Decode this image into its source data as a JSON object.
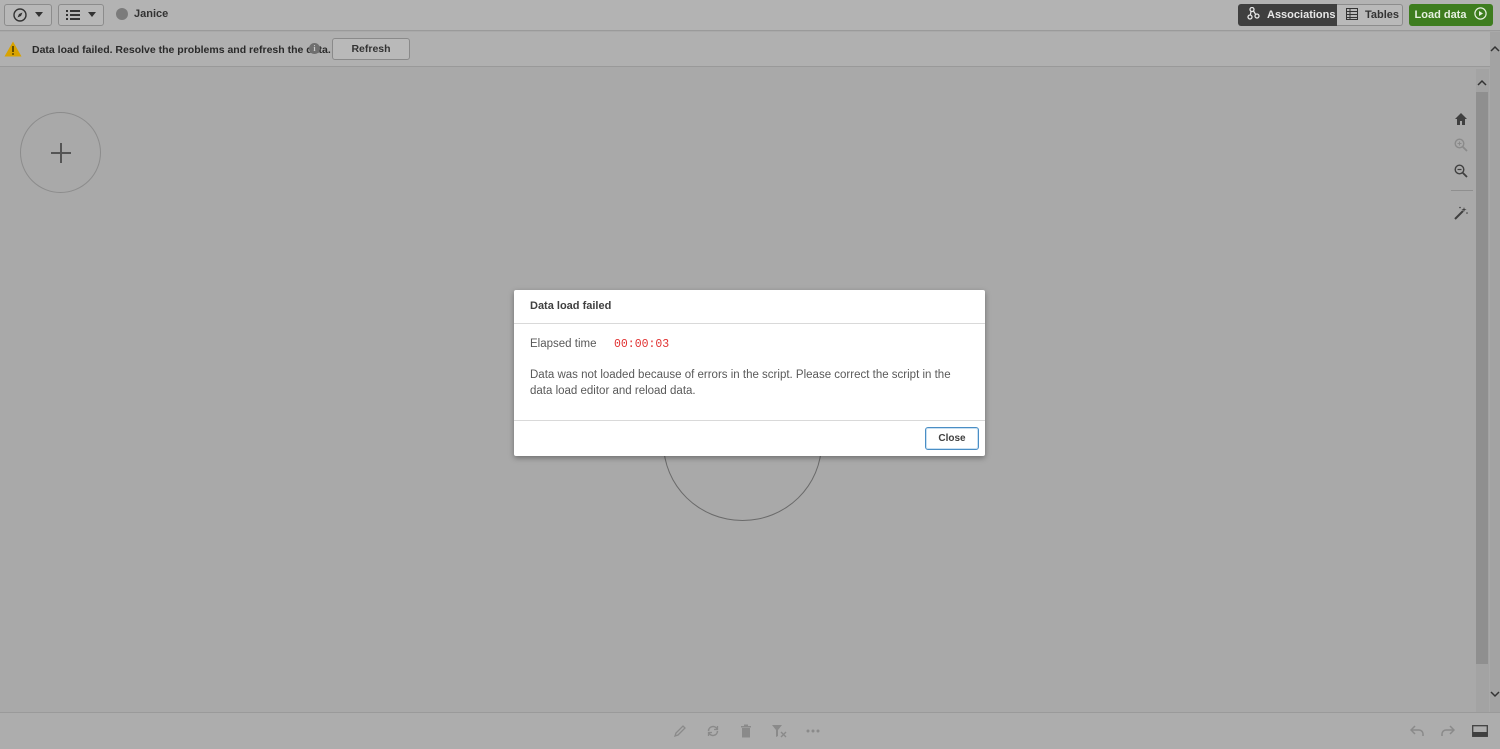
{
  "toolbar": {
    "navigation_icon": "compass-icon",
    "menu_icon": "list-menu-icon",
    "app_name": "Janice",
    "associations_label": "Associations",
    "tables_label": "Tables",
    "load_data_label": "Load data"
  },
  "warning": {
    "message": "Data load failed. Resolve the problems and refresh the data.",
    "info_symbol": "i",
    "refresh_label": "Refresh"
  },
  "canvas": {
    "add_symbol": "+"
  },
  "modal": {
    "title": "Data load failed",
    "elapsed_label": "Elapsed time",
    "elapsed_value": "00:00:03",
    "message": "Data was not loaded because of errors in the script. Please correct the script in the data load editor and reload data.",
    "close_label": "Close"
  },
  "right_rail": [
    "home-icon",
    "zoom-in-icon",
    "zoom-out-icon",
    "magic-wand-icon"
  ],
  "bottom_bar": [
    "edit-icon",
    "sync-icon",
    "delete-icon",
    "filter-icon",
    "more-icon",
    "undo-icon",
    "redo-icon",
    "panel-icon"
  ],
  "colors": {
    "load_button": "#3e7d1f",
    "associations_active": "#3f3f3f",
    "warning": "#d9a300",
    "elapsed_value": "#e03030",
    "close_button_border": "#4a8ec5"
  }
}
